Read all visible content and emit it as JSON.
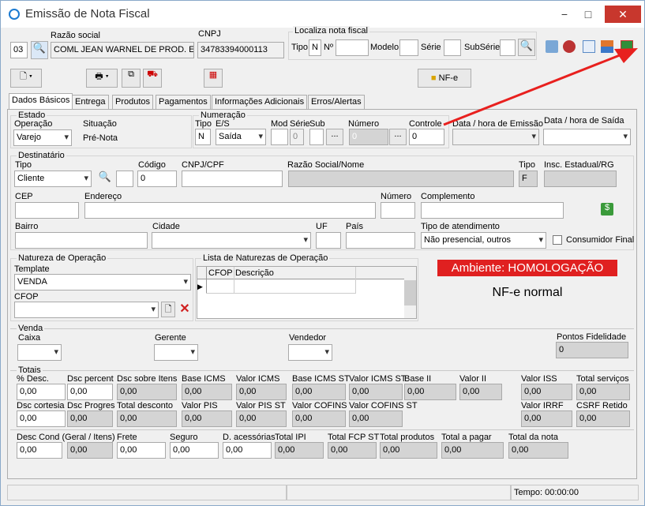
{
  "window": {
    "title": "Emissão de Nota Fiscal",
    "min": "−",
    "max": "□",
    "close": "✕"
  },
  "header": {
    "code": "03",
    "razao_label": "Razão social",
    "razao": "COML JEAN WARNEL DE PROD. ESP.",
    "cnpj_label": "CNPJ",
    "cnpj": "34783394000113",
    "localiza_label": "Localiza nota fiscal",
    "tipo_label": "Tipo",
    "tipo": "N",
    "no_label": "Nº",
    "modelo_label": "Modelo",
    "serie_label": "Série",
    "subserie_label": "SubSérie"
  },
  "toolbar": {
    "nfe_label": "NF-e"
  },
  "tabs": [
    "Dados Básicos",
    "Entrega",
    "Produtos",
    "Pagamentos",
    "Informações Adicionais",
    "Erros/Alertas"
  ],
  "estado": {
    "title": "Estado",
    "operacao_label": "Operação",
    "operacao": "Varejo",
    "situacao_label": "Situação",
    "situacao": "Pré-Nota"
  },
  "numeracao": {
    "title": "Numeração",
    "tipo_label": "Tipo",
    "tipo": "N",
    "es_label": "E/S",
    "es": "Saída",
    "mod_label": "Mod",
    "serie_label": "Série",
    "serie": "0",
    "sub_label": "Sub",
    "numero_label": "Número",
    "numero": "0",
    "controle_label": "Controle",
    "controle": "0",
    "dots": "..."
  },
  "datas": {
    "emissao_label": "Data / hora de Emissão",
    "saida_label": "Data / hora de Saída"
  },
  "destinatario": {
    "title": "Destinatário",
    "tipo_label": "Tipo",
    "tipo": "Cliente",
    "codigo_label": "Código",
    "codigo": "0",
    "cnpj_label": "CNPJ/CPF",
    "razao_label": "Razão Social/Nome",
    "tipo2_label": "Tipo",
    "tipo2": "F",
    "ie_label": "Insc. Estadual/RG",
    "cep_label": "CEP",
    "endereco_label": "Endereço",
    "numero_label": "Número",
    "complemento_label": "Complemento",
    "bairro_label": "Bairro",
    "cidade_label": "Cidade",
    "uf_label": "UF",
    "pais_label": "País",
    "atendimento_label": "Tipo de atendimento",
    "atendimento": "Não presencial, outros",
    "consumidor_label": "Consumidor Final"
  },
  "natureza": {
    "title": "Natureza de Operação",
    "template_label": "Template",
    "template": "VENDA",
    "cfop_label": "CFOP"
  },
  "lista": {
    "title": "Lista de Naturezas de Operação",
    "col_cfop": "CFOP",
    "col_desc": "Descrição"
  },
  "ambiente": {
    "text": "Ambiente: HOMOLOGAÇÃO",
    "color": "#e02020",
    "modo": "NF-e normal"
  },
  "venda": {
    "title": "Venda",
    "caixa_label": "Caixa",
    "gerente_label": "Gerente",
    "vendedor_label": "Vendedor",
    "pontos_label": "Pontos Fidelidade",
    "pontos": "0"
  },
  "totais": {
    "title": "Totais",
    "row1": [
      {
        "l": "% Desc.",
        "v": "0,00"
      },
      {
        "l": "Dsc percent",
        "v": "0,00"
      },
      {
        "l": "Dsc sobre Itens",
        "v": "0,00"
      },
      {
        "l": "Base ICMS",
        "v": "0,00"
      },
      {
        "l": "Valor ICMS",
        "v": "0,00"
      },
      {
        "l": "Base ICMS ST",
        "v": "0,00"
      },
      {
        "l": "Valor ICMS ST",
        "v": "0,00"
      },
      {
        "l": "Base II",
        "v": "0,00"
      },
      {
        "l": "Valor II",
        "v": "0,00"
      },
      {
        "l": "Valor ISS",
        "v": "0,00"
      },
      {
        "l": "Total serviços",
        "v": "0,00"
      }
    ],
    "row2": [
      {
        "l": "Dsc cortesia",
        "v": "0,00"
      },
      {
        "l": "Dsc Progres",
        "v": "0,00"
      },
      {
        "l": "Total desconto",
        "v": "0,00"
      },
      {
        "l": "Valor PIS",
        "v": "0,00"
      },
      {
        "l": "Valor PIS ST",
        "v": "0,00"
      },
      {
        "l": "Valor COFINS",
        "v": "0,00"
      },
      {
        "l": "Valor COFINS ST",
        "v": "0,00"
      },
      {
        "l": "Valor IRRF",
        "v": "0,00"
      },
      {
        "l": "CSRF Retido",
        "v": "0,00"
      }
    ],
    "row3": [
      {
        "l": "Desc Cond (Geral / Itens)",
        "v": "0,00"
      },
      {
        "l": "",
        "v": "0,00"
      },
      {
        "l": "Frete",
        "v": "0,00"
      },
      {
        "l": "Seguro",
        "v": "0,00"
      },
      {
        "l": "D. acessórias",
        "v": "0,00"
      },
      {
        "l": "Total IPI",
        "v": "0,00"
      },
      {
        "l": "Total FCP ST",
        "v": "0,00"
      },
      {
        "l": "Total produtos",
        "v": "0,00"
      },
      {
        "l": "Total a pagar",
        "v": "0,00"
      },
      {
        "l": "Total da nota",
        "v": "0,00"
      }
    ]
  },
  "status": {
    "tempo": "Tempo: 00:00:00"
  }
}
